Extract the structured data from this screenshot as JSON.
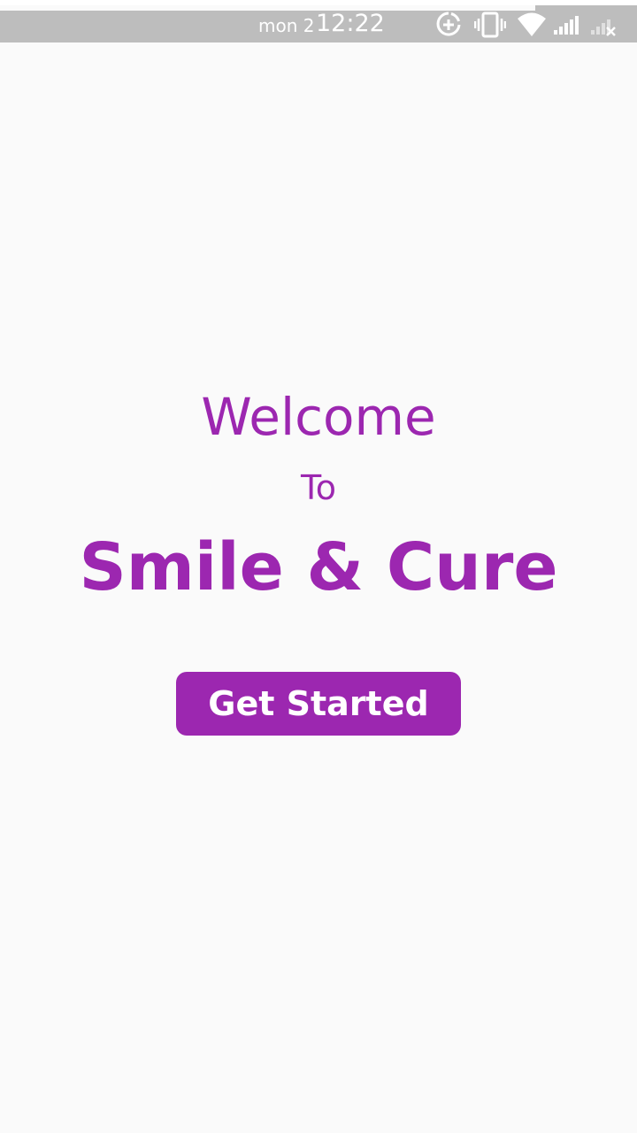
{
  "status_bar": {
    "date": "mon 2",
    "time": "12:22",
    "icons": [
      "data-saver-icon",
      "vibrate-icon",
      "wifi-icon",
      "signal-icon",
      "signal-no-sim-icon"
    ]
  },
  "welcome": {
    "line1": "Welcome",
    "line2": "To",
    "app_name": "Smile & Cure"
  },
  "actions": {
    "get_started_label": "Get Started"
  },
  "colors": {
    "accent": "#9c27b0",
    "background": "#fafafa",
    "status_bar": "#bdbdbd"
  }
}
